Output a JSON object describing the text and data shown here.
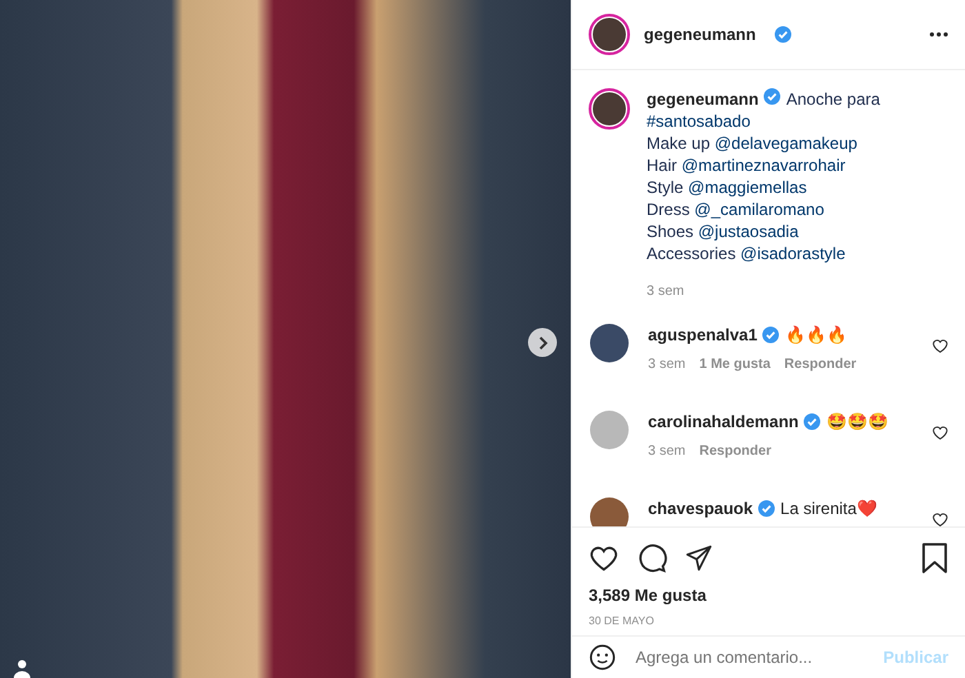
{
  "header": {
    "username": "gegeneumann",
    "verified": true
  },
  "caption": {
    "username": "gegeneumann",
    "verified": true,
    "time": "3 sem",
    "lines": [
      [
        {
          "kind": "text",
          "text": "Anoche para"
        }
      ],
      [
        {
          "kind": "hashtag",
          "text": "#santosabado"
        }
      ],
      [
        {
          "kind": "text",
          "text": "Make up "
        },
        {
          "kind": "mention",
          "text": "@delavegamakeup"
        }
      ],
      [
        {
          "kind": "text",
          "text": "Hair "
        },
        {
          "kind": "mention",
          "text": "@martineznavarrohair"
        }
      ],
      [
        {
          "kind": "text",
          "text": "Style "
        },
        {
          "kind": "mention",
          "text": "@maggiemellas"
        }
      ],
      [
        {
          "kind": "text",
          "text": "Dress "
        },
        {
          "kind": "mention",
          "text": "@_camilaromano"
        }
      ],
      [
        {
          "kind": "text",
          "text": "Shoes "
        },
        {
          "kind": "mention",
          "text": "@justaosadia"
        }
      ],
      [
        {
          "kind": "text",
          "text": "Accessories "
        },
        {
          "kind": "mention",
          "text": "@isadorastyle"
        }
      ]
    ]
  },
  "comments": [
    {
      "username": "aguspenalva1",
      "verified": true,
      "text": "🔥🔥🔥",
      "time": "3 sem",
      "likes": "1 Me gusta",
      "reply": "Responder",
      "liked": false
    },
    {
      "username": "carolinahaldemann",
      "verified": true,
      "text": "🤩🤩🤩",
      "time": "3 sem",
      "reply": "Responder",
      "liked": false
    },
    {
      "username": "chavespauok",
      "verified": true,
      "text": "La sirenita❤️",
      "liked": false
    }
  ],
  "actions": {
    "liked": false,
    "saved": false
  },
  "likes": "3,589 Me gusta",
  "date": "30 DE MAYO",
  "comment_box": {
    "placeholder": "Agrega un comentario...",
    "button": "Publicar",
    "disabled": true
  }
}
